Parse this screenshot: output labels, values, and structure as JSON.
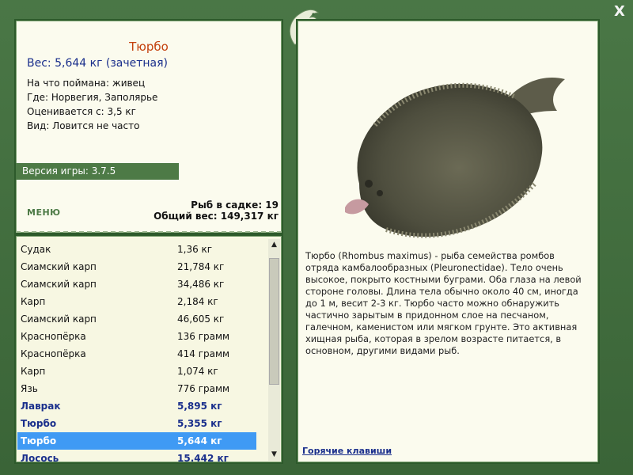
{
  "fish": {
    "name": "Тюрбо",
    "weight_line": "Вес: 5,644 кг (зачетная)",
    "caught_on": "На что поймана: живец",
    "where": "Где: Норвегия, Заполярье",
    "rated_from": "Оценивается с: 3,5 кг",
    "kind": "Вид: Ловится не часто"
  },
  "version": "Версия игры: 3.7.5",
  "menu_label": "МЕНЮ",
  "stats": {
    "fish_in_cage": "Рыб в садке: 19",
    "total_weight": "Общий вес: 149,317 кг"
  },
  "catch_list": [
    {
      "name": "Судак",
      "weight": "1,36 кг",
      "bold": false
    },
    {
      "name": "Сиамский карп",
      "weight": "21,784 кг",
      "bold": false
    },
    {
      "name": "Сиамский карп",
      "weight": "34,486 кг",
      "bold": false
    },
    {
      "name": "Карп",
      "weight": "2,184 кг",
      "bold": false
    },
    {
      "name": "Сиамский карп",
      "weight": "46,605 кг",
      "bold": false
    },
    {
      "name": "Краснопёрка",
      "weight": "136 грамм",
      "bold": false
    },
    {
      "name": "Краснопёрка",
      "weight": "414 грамм",
      "bold": false
    },
    {
      "name": "Карп",
      "weight": "1,074 кг",
      "bold": false
    },
    {
      "name": "Язь",
      "weight": "776 грамм",
      "bold": false
    },
    {
      "name": "Лаврак",
      "weight": "5,895 кг",
      "bold": true
    },
    {
      "name": "Тюрбо",
      "weight": "5,355 кг",
      "bold": true
    },
    {
      "name": "Тюрбо",
      "weight": "5,644 кг",
      "bold": true,
      "selected": true
    },
    {
      "name": "Лосось",
      "weight": "15.442 кг",
      "bold": true
    }
  ],
  "description": "Тюрбо (Rhombus maximus) - рыба семейства ромбов отряда камбалообразных (Pleuronectidae). Тело очень высокое, покрыто костными буграми. Оба глаза на левой стороне головы. Длина тела обычно около 40 см, иногда до 1 м, весит 2-3 кг. Тюрбо часто можно обнаружить частично зарытым в придонном слое на песчаном, галечном, каменистом или мягком грунте. Это активная хищная рыба, которая в зрелом возрасте питается, в основном, другими видами рыб.",
  "hotkeys_label": "Горячие клавиши",
  "close_symbol": "X",
  "colors": {
    "frame": "#3f6a3c",
    "panel": "#fbfbee",
    "accent_blue": "#1a2f8c",
    "title": "#c4410d",
    "selected": "#3f9af4"
  }
}
